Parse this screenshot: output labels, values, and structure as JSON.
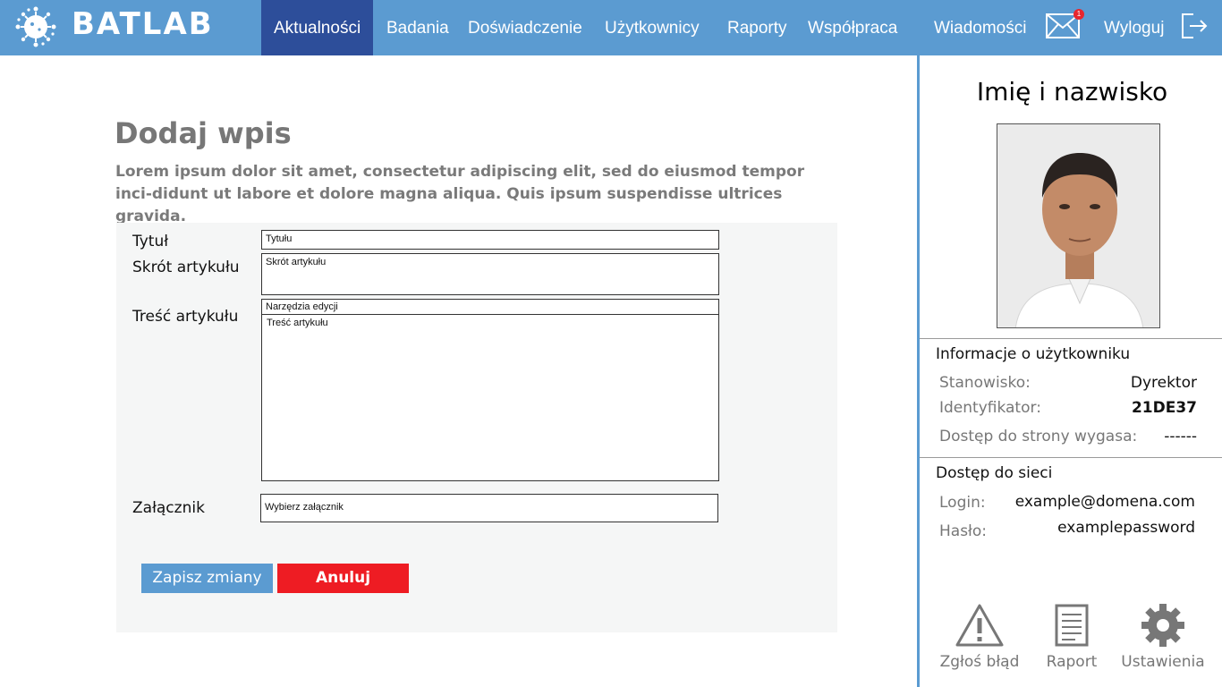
{
  "app": {
    "brand": "BATLAB"
  },
  "nav": {
    "items": [
      {
        "label": "Aktualności"
      },
      {
        "label": "Badania"
      },
      {
        "label": "Doświadczenie"
      },
      {
        "label": "Użytkownicy"
      },
      {
        "label": "Raporty"
      },
      {
        "label": "Współpraca"
      },
      {
        "label": "Wiadomości"
      }
    ],
    "messages_badge": "1",
    "logout_label": "Wyloguj"
  },
  "main": {
    "title": "Dodaj wpis",
    "lead": "Lorem ipsum dolor sit amet, consectetur adipiscing elit, sed do eiusmod tempor inci-didunt ut labore et dolore magna aliqua. Quis ipsum suspendisse ultrices gravida.",
    "form": {
      "title_label": "Tytuł",
      "title_placeholder": "Tytułu",
      "summary_label": "Skrót artykułu",
      "summary_placeholder": "Skrót artykułu",
      "content_label": "Treść artykułu",
      "content_toolbar": "Narzędzia edycji",
      "content_placeholder": "Treść artykułu",
      "attachment_label": "Załącznik",
      "attachment_placeholder": "Wybierz załącznik"
    },
    "save_label": "Zapisz zmiany",
    "cancel_label": "Anuluj"
  },
  "sidebar": {
    "name": "Imię i nazwisko",
    "info_title": "Informacje o użytkowniku",
    "position_key": "Stanowisko:",
    "position_val": "Dyrektor",
    "id_key": "Identyfikator:",
    "id_val": "21DE37",
    "expiry_key": "Dostęp do strony wygasa:",
    "expiry_val": "------",
    "network_title": "Dostęp do sieci",
    "login_key": "Login:",
    "login_val": "example@domena.com",
    "password_key": "Hasło:",
    "password_val": "examplepassword",
    "tools": [
      {
        "label": "Zgłoś błąd",
        "icon": "warning-icon"
      },
      {
        "label": "Raport",
        "icon": "document-icon"
      },
      {
        "label": "Ustawienia",
        "icon": "gear-icon"
      }
    ]
  },
  "colors": {
    "topbar": "#5b9bd1",
    "nav_active": "#2d4e9a",
    "save_button": "#5b9bd1",
    "cancel_button": "#ee1c23",
    "badge": "#e8262d"
  }
}
